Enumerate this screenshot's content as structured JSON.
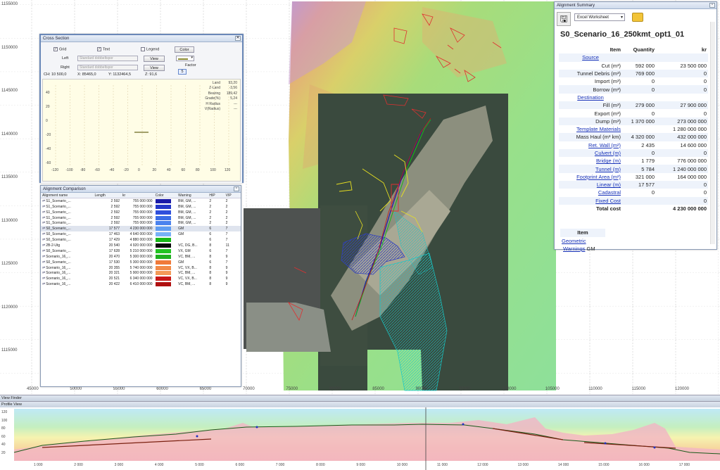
{
  "map": {
    "y_axis_labels": [
      "1155000",
      "1150000",
      "1145000",
      "1140000",
      "1135000",
      "1130000",
      "1125000",
      "1120000",
      "1115000"
    ],
    "x_axis_labels": [
      "45000",
      "50000",
      "55000",
      "60000",
      "65000",
      "70000",
      "75000",
      "80000",
      "85000",
      "90000",
      "95000",
      "100000",
      "105000",
      "110000",
      "115000",
      "120000"
    ]
  },
  "cross_section": {
    "title": "Cross Section",
    "grid_label": "Grid",
    "text_label": "Text",
    "legend_label": "Legend",
    "color_button": "Color",
    "left_label": "Left",
    "right_label": "Right",
    "left_value": "Standard dobbeltspor",
    "right_value": "Standard dobbeltspor",
    "view_label": "View",
    "factor_label": "Factor",
    "factor_value": "5",
    "ch": "CH: 10 500,0",
    "x": "X: 85465,0",
    "y": "Y: 1132464,5",
    "z": "Z: 91,6",
    "info_labels": [
      "Land",
      "Z-Land",
      "Bearing",
      "Grade(%)",
      "H Radius",
      "V(Radius)"
    ],
    "info_values": [
      "93,20",
      "-3,56",
      "189,42",
      "5,24",
      "---",
      "---"
    ],
    "y_ticks": [
      "40",
      "20",
      "0",
      "-20",
      "-40",
      "-60"
    ],
    "x_ticks": [
      "-120",
      "-100",
      "-80",
      "-60",
      "-40",
      "-20",
      "0",
      "20",
      "40",
      "60",
      "80",
      "100",
      "120"
    ]
  },
  "comparison": {
    "title": "Alignment Comparison",
    "headers": [
      "Alignment name",
      "Length",
      "kr",
      "Color",
      "Warning",
      "HIP",
      "VIP"
    ],
    "rows": [
      {
        "name": "S1_Scenario_...",
        "length": "2 592",
        "kr": "755 000 000",
        "color": "#1a1aa8",
        "warning": "BM, GM, ...",
        "hip": "2",
        "vip": "2"
      },
      {
        "name": "S1_Scenario_...",
        "length": "2 592",
        "kr": "755 000 000",
        "color": "#2437c8",
        "warning": "BM, GM, ...",
        "hip": "2",
        "vip": "2"
      },
      {
        "name": "S1_Scenario_...",
        "length": "2 592",
        "kr": "755 000 000",
        "color": "#3050dc",
        "warning": "BM, GM, ...",
        "hip": "2",
        "vip": "2"
      },
      {
        "name": "S1_Scenario_...",
        "length": "2 592",
        "kr": "755 000 000",
        "color": "#3c6ee6",
        "warning": "BM, GM, ...",
        "hip": "2",
        "vip": "2"
      },
      {
        "name": "S1_Scenario_...",
        "length": "2 592",
        "kr": "755 000 000",
        "color": "#4a82ee",
        "warning": "BM, GM, ...",
        "hip": "2",
        "vip": "2"
      },
      {
        "name": "S0_Scenario_...",
        "length": "17 577",
        "kr": "4 230 000 000",
        "color": "#5f9cf2",
        "warning": "GM",
        "hip": "6",
        "vip": "7"
      },
      {
        "name": "S0_Scenario_...",
        "length": "17 463",
        "kr": "4 640 000 000",
        "color": "#78b2f6",
        "warning": "GM",
        "hip": "6",
        "vip": "7"
      },
      {
        "name": "S0_Scenario_...",
        "length": "17 429",
        "kr": "4 880 000 000",
        "color": "#18b818",
        "warning": "",
        "hip": "6",
        "vip": "7"
      },
      {
        "name": "2B-2-Utg",
        "length": "20 540",
        "kr": "4 920 000 000",
        "color": "#0a0a0a",
        "warning": "VC, DG, B...",
        "hip": "8",
        "vip": "11"
      },
      {
        "name": "S0_Scenario_...",
        "length": "17 628",
        "kr": "5 210 000 000",
        "color": "#22c422",
        "warning": "VX, GM",
        "hip": "6",
        "vip": "7"
      },
      {
        "name": "Scenario_16_...",
        "length": "20 470",
        "kr": "5 300 000 000",
        "color": "#20b020",
        "warning": "VC, BM, ...",
        "hip": "8",
        "vip": "9"
      },
      {
        "name": "S0_Scenario_...",
        "length": "17 530",
        "kr": "5 300 000 000",
        "color": "#f07a3a",
        "warning": "GM",
        "hip": "6",
        "vip": "7"
      },
      {
        "name": "Scenario_16_...",
        "length": "20 355",
        "kr": "5 740 000 000",
        "color": "#f28a48",
        "warning": "VC, VX, B...",
        "hip": "8",
        "vip": "9"
      },
      {
        "name": "Scenario_16_...",
        "length": "20 321",
        "kr": "5 900 000 000",
        "color": "#f49a58",
        "warning": "VC, BM, ...",
        "hip": "8",
        "vip": "9"
      },
      {
        "name": "Scenario_16_...",
        "length": "20 521",
        "kr": "6 340 000 000",
        "color": "#c81818",
        "warning": "VC, VX, B...",
        "hip": "8",
        "vip": "9"
      },
      {
        "name": "Scenario_16_...",
        "length": "20 422",
        "kr": "6 410 000 000",
        "color": "#b01010",
        "warning": "VC, BM, ...",
        "hip": "8",
        "vip": "9"
      }
    ]
  },
  "summary": {
    "title": "Alignment Summary",
    "export_option": "Excel Worksheet",
    "scenario": "S0_Scenario_16_250kmt_opt1_01",
    "col_item": "Item",
    "col_quantity": "Quantity",
    "col_kr": "kr",
    "rows": [
      {
        "item": "Source",
        "qty": "",
        "kr": "",
        "link": true,
        "center": true
      },
      {
        "item": "Cut (m³)",
        "qty": "592 000",
        "kr": "23 500 000"
      },
      {
        "item": "Tunnel Debris (m³)",
        "qty": "769 000",
        "kr": "0"
      },
      {
        "item": "Import (m³)",
        "qty": "0",
        "kr": "0"
      },
      {
        "item": "Borrow (m³)",
        "qty": "0",
        "kr": "0"
      },
      {
        "item": "Destination",
        "qty": "",
        "kr": "",
        "link": true,
        "center": true
      },
      {
        "item": "Fill (m³)",
        "qty": "279 000",
        "kr": "27 900 000"
      },
      {
        "item": "Export (m³)",
        "qty": "0",
        "kr": "0"
      },
      {
        "item": "Dump (m³)",
        "qty": "1 370 000",
        "kr": "273 000 000"
      },
      {
        "item": "Template Materials",
        "qty": "",
        "kr": "1 280 000 000",
        "link": true
      },
      {
        "item": "Mass Haul (m³ km)",
        "qty": "4 320 000",
        "kr": "432 000 000"
      },
      {
        "item": "Ret. Wall (m²)",
        "qty": "2 435",
        "kr": "14 600 000",
        "link": true
      },
      {
        "item": "Culvert (m)",
        "qty": "0",
        "kr": "0",
        "link": true
      },
      {
        "item": "Bridge (m)",
        "qty": "1 779",
        "kr": "776 000 000",
        "link": true
      },
      {
        "item": "Tunnel (m)",
        "qty": "5 784",
        "kr": "1 240 000 000",
        "link": true
      },
      {
        "item": "Footprint Area (m²)",
        "qty": "321 000",
        "kr": "164 000 000",
        "link": true
      },
      {
        "item": "Linear (m)",
        "qty": "17 577",
        "kr": "0",
        "link": true
      },
      {
        "item": "Cadastral",
        "qty": "0",
        "kr": "0",
        "link": true
      },
      {
        "item": "Fixed Cost",
        "qty": "",
        "kr": "0",
        "link": true
      },
      {
        "item": "Total cost",
        "qty": "",
        "kr": "4 230 000 000",
        "bold": true
      }
    ],
    "item2_header": "Item",
    "geometric": "Geometric",
    "warnings": "Warnings",
    "warnings_value": "GM"
  },
  "view_finder": {
    "title": "View Finder"
  },
  "profile": {
    "title": "Profile View",
    "y_ticks": [
      "120",
      "100",
      "80",
      "60",
      "40",
      "20"
    ],
    "x_ticks": [
      "1 000",
      "2 000",
      "3 000",
      "4 000",
      "5 000",
      "6 000",
      "7 000",
      "8 000",
      "9 000",
      "10 000",
      "11 000",
      "12 000",
      "13 000",
      "14 000",
      "15 000",
      "16 000",
      "17 000"
    ]
  }
}
